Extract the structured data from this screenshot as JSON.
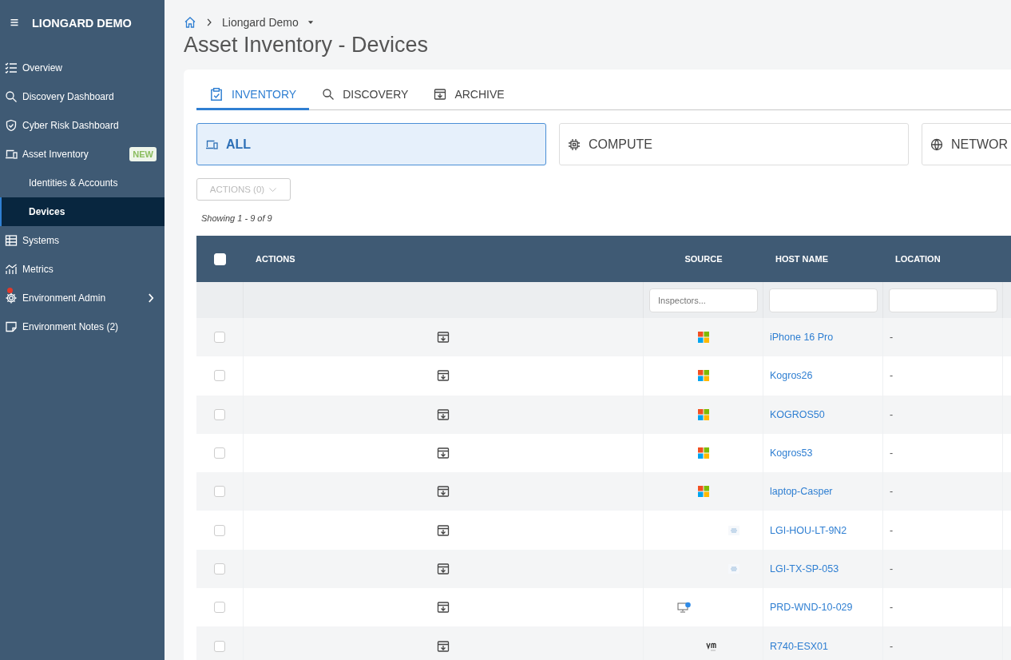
{
  "sidebar": {
    "title": "LIONGARD DEMO",
    "items": [
      {
        "label": "Overview",
        "kind": "checklist",
        "selected": false
      },
      {
        "label": "Discovery Dashboard",
        "kind": "search",
        "selected": false
      },
      {
        "label": "Cyber Risk Dashboard",
        "kind": "shield",
        "selected": false
      },
      {
        "label": "Asset Inventory",
        "kind": "devices",
        "selected": false,
        "badge": "NEW",
        "children": [
          {
            "label": "Identities & Accounts",
            "selected": false
          },
          {
            "label": "Devices",
            "selected": true
          }
        ]
      },
      {
        "label": "Systems",
        "kind": "table",
        "selected": false
      },
      {
        "label": "Metrics",
        "kind": "chart",
        "selected": false
      },
      {
        "label": "Environment Admin",
        "kind": "gear",
        "selected": false,
        "alert": true,
        "expandable": true
      },
      {
        "label": "Environment Notes (2)",
        "kind": "note",
        "selected": false
      }
    ]
  },
  "breadcrumb": {
    "current": "Liongard Demo"
  },
  "page_title": "Asset Inventory - Devices",
  "tabs": [
    {
      "label": "INVENTORY",
      "kind": "clipboard",
      "selected": true
    },
    {
      "label": "DISCOVERY",
      "kind": "search",
      "selected": false
    },
    {
      "label": "ARCHIVE",
      "kind": "archive",
      "selected": false
    }
  ],
  "categories": [
    {
      "label": "ALL",
      "kind": "devices",
      "selected": true
    },
    {
      "label": "COMPUTE",
      "kind": "chip",
      "selected": false
    },
    {
      "label": "NETWOR",
      "kind": "globe",
      "selected": false
    }
  ],
  "actions_button": {
    "label": "ACTIONS (0)",
    "disabled": true
  },
  "showing": "Showing 1 - 9 of 9",
  "table": {
    "all_checked": false,
    "columns": [
      "ACTIONS",
      "SOURCE",
      "HOST NAME",
      "LOCATION"
    ],
    "filters": {
      "source": {
        "placeholder": "Inspectors..."
      }
    },
    "rows": [
      {
        "checked": false,
        "kind": "windows",
        "host": "iPhone 16 Pro",
        "location": "-"
      },
      {
        "checked": false,
        "kind": "windows",
        "host": "Kogros26",
        "location": "-"
      },
      {
        "checked": false,
        "kind": "windows",
        "host": "KOGROS50",
        "location": "-"
      },
      {
        "checked": false,
        "kind": "windows",
        "host": "Kogros53",
        "location": "-"
      },
      {
        "checked": false,
        "kind": "windows",
        "host": "laptop-Casper",
        "location": "-"
      },
      {
        "checked": false,
        "kind": "cisco",
        "host": "LGI-HOU-LT-9N2",
        "location": "-"
      },
      {
        "checked": false,
        "kind": "cisco",
        "host": "LGI-TX-SP-053",
        "location": "-"
      },
      {
        "checked": false,
        "kind": "monitor",
        "host": "PRD-WND-10-029",
        "location": "-"
      },
      {
        "checked": false,
        "kind": "vmware",
        "host": "R740-ESX01",
        "location": "-"
      }
    ]
  }
}
